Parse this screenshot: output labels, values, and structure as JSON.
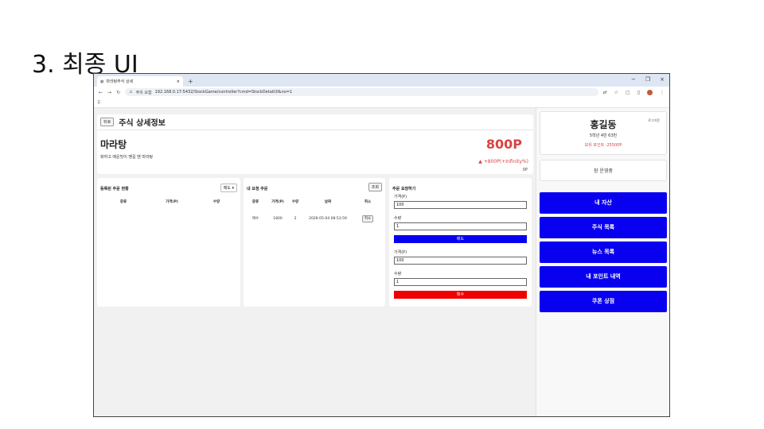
{
  "slide": {
    "title": "3. 최종 UI"
  },
  "browser": {
    "tab_title": "마라탕주식 상세",
    "tab_close": "×",
    "new_tab": "+",
    "url_warning": "주의 요함",
    "url": "192.168.0.17:5432/StockGame/controller?cmd=StockDetailUI&no=1",
    "controls": {
      "minimize": "−",
      "maximize": "❐",
      "close": "×"
    },
    "nav": {
      "back": "←",
      "forward": "→",
      "reload": "↻"
    },
    "apps_icon": "⠿"
  },
  "page": {
    "back_label": "뒤로",
    "title": "주식 상세정보",
    "stock": {
      "name": "마라탕",
      "description": "화하고 매운맛이 땡길 땐 마라탕",
      "price": "800P",
      "change": "▲ +800P(+Infinity%)",
      "sub_value": "0P"
    },
    "registered_orders": {
      "title": "등록된 주문 현황",
      "filter_value": "매도 ▾",
      "columns": [
        "종류",
        "가격(P)",
        "수량"
      ]
    },
    "my_orders": {
      "title": "내 요청 주문",
      "query_label": "조회",
      "columns": [
        "종류",
        "가격(P)",
        "수량",
        "날짜",
        "취소"
      ],
      "rows": [
        {
          "type": "매수",
          "price": "1800",
          "qty": "2",
          "date": "2026-05-04 08:53:59",
          "cancel": "취소"
        }
      ]
    },
    "order_form": {
      "title": "주문 요청하기",
      "sell": {
        "price_label": "가격(P)",
        "price_value": "100",
        "qty_label": "수량",
        "qty_value": "1",
        "submit": "매도"
      },
      "buy": {
        "price_label": "가격(P)",
        "price_value": "100",
        "qty_label": "수량",
        "qty_value": "1",
        "submit": "매수"
      }
    }
  },
  "sidebar": {
    "user_name": "홍길동",
    "logout": "로그아웃",
    "user_class": "5학년 4반 63번",
    "points": "보유 포인트 :25500P",
    "market_status": "장 운영중",
    "nav": [
      "내 자산",
      "주식 목록",
      "뉴스 목록",
      "내 포인트 내역",
      "쿠폰 상점"
    ]
  },
  "colors": {
    "accent_blue": "#0a00f0",
    "sell": "#0a00f0",
    "buy": "#f00000",
    "price_red": "#d84343"
  }
}
